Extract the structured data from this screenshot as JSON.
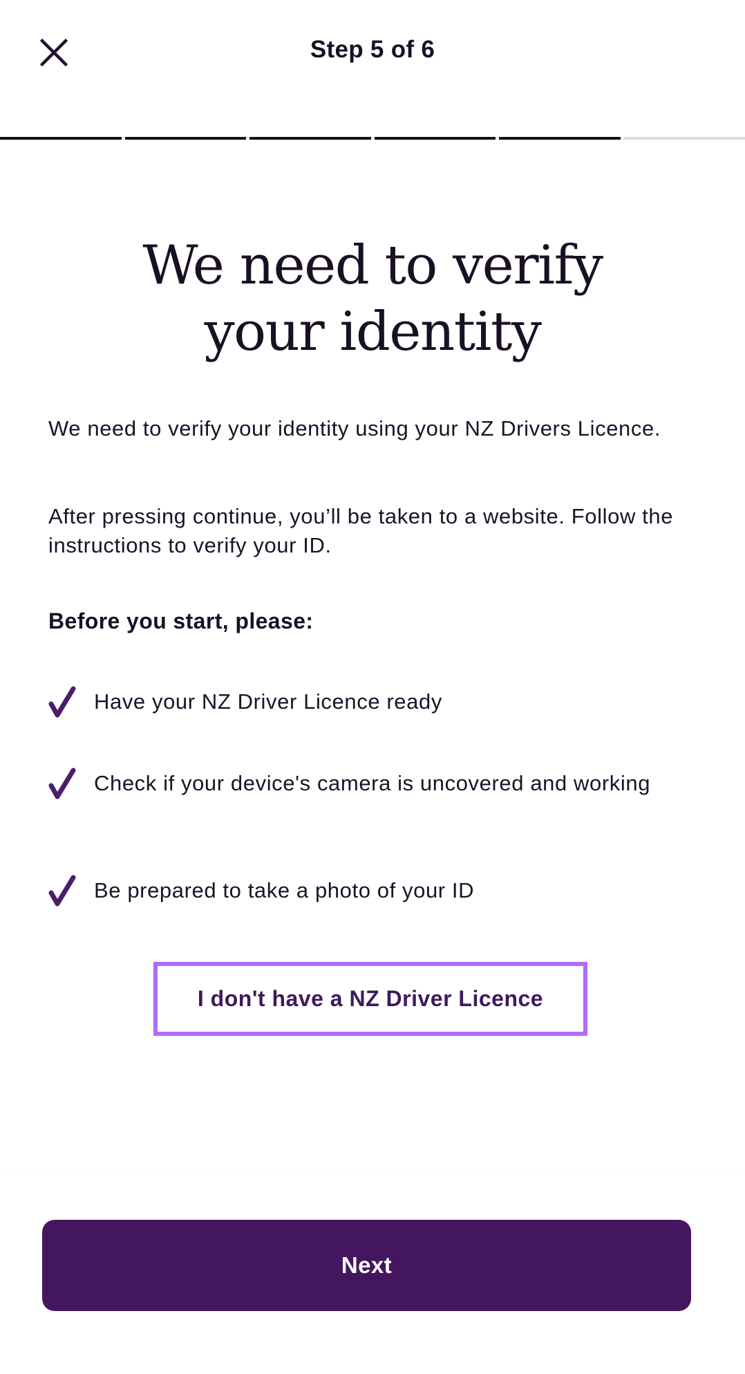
{
  "header": {
    "close_icon": "close-icon",
    "step_label": "Step 5 of 6"
  },
  "progress": {
    "current_step": 5,
    "total_steps": 6,
    "completed_color": "#15101c",
    "remaining_color": "#dcdcdc"
  },
  "main": {
    "title_line1": "We need to verify",
    "title_line2": "your identity",
    "paragraph1": "We need to verify your identity using your NZ Drivers Licence.",
    "paragraph2": "After pressing continue, you’ll be taken to a website. Follow the instructions to verify your ID.",
    "checklist_heading": "Before you start, please:",
    "checklist": [
      {
        "icon": "check-icon",
        "text": "Have your NZ Driver Licence ready"
      },
      {
        "icon": "check-icon",
        "text": "Check if your device's camera is uncovered and working"
      },
      {
        "icon": "check-icon",
        "text": "Be prepared to take a photo of your ID"
      }
    ],
    "alt_link_label": "I don't have a NZ Driver Licence"
  },
  "footer": {
    "next_label": "Next"
  },
  "colors": {
    "brand_purple": "#44165f",
    "check_purple": "#4a1e6a",
    "focus_outline": "#b36bf5",
    "text_dark": "#1a1025"
  }
}
